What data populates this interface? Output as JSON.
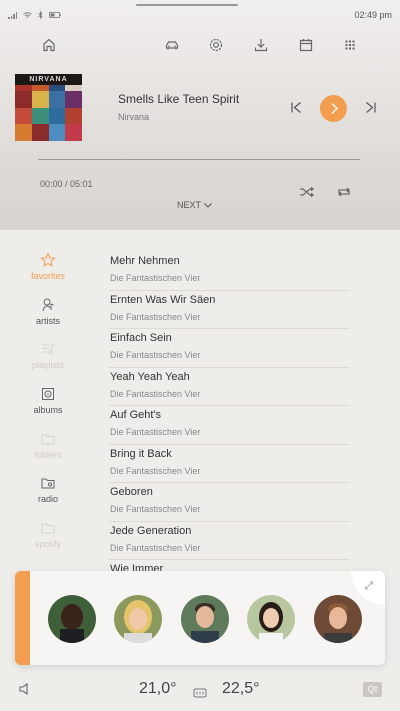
{
  "status_bar": {
    "clock": "02:49 pm"
  },
  "now_playing": {
    "album_banner": "NIRVANA",
    "title": "Smells Like Teen Spirit",
    "artist": "Nirvana",
    "time": "00:00 / 05:01",
    "progress": 0,
    "next_label": "NEXT"
  },
  "sidebar": {
    "items": [
      {
        "label": "favorites",
        "icon": "star-icon",
        "state": "active"
      },
      {
        "label": "artists",
        "icon": "artist-icon",
        "state": "normal"
      },
      {
        "label": "playlists",
        "icon": "playlist-icon",
        "state": "disabled"
      },
      {
        "label": "albums",
        "icon": "album-icon",
        "state": "normal"
      },
      {
        "label": "folders",
        "icon": "folder-icon",
        "state": "disabled"
      },
      {
        "label": "radio",
        "icon": "radio-icon",
        "state": "normal"
      },
      {
        "label": "spotify",
        "icon": "spotify-icon",
        "state": "disabled"
      }
    ]
  },
  "tracks": [
    {
      "title": "Mehr Nehmen",
      "artist": "Die Fantastischen Vier"
    },
    {
      "title": "Ernten Was Wir Säen",
      "artist": "Die Fantastischen Vier"
    },
    {
      "title": "Einfach Sein",
      "artist": "Die Fantastischen Vier"
    },
    {
      "title": "Yeah Yeah Yeah",
      "artist": "Die Fantastischen Vier"
    },
    {
      "title": "Auf Geht's",
      "artist": "Die Fantastischen Vier"
    },
    {
      "title": "Bring it Back",
      "artist": "Die Fantastischen Vier"
    },
    {
      "title": "Geboren",
      "artist": "Die Fantastischen Vier"
    },
    {
      "title": "Jede Generation",
      "artist": "Die Fantastischen Vier"
    },
    {
      "title": "Wie Immer",
      "artist": ""
    }
  ],
  "climate": {
    "left_temp": "21,0°",
    "right_temp": "22,5°"
  },
  "branding": {
    "qt": "Qt"
  },
  "colors": {
    "accent": "#f29d4f"
  }
}
